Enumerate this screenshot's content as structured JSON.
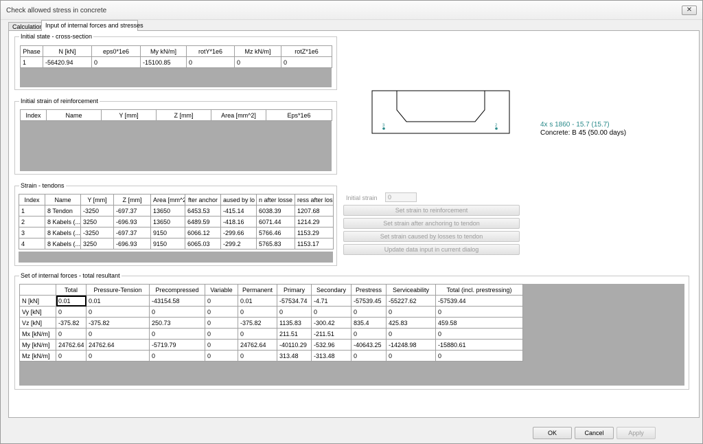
{
  "window": {
    "title": "Check allowed stress in concrete"
  },
  "tabs": [
    {
      "label": "Calculation"
    },
    {
      "label": "Input of internal forces and stresses"
    }
  ],
  "initial_state": {
    "title": "Initial state - cross-section",
    "columns": [
      "Phase",
      "N [kN]",
      "eps0*1e6",
      "My kN/m]",
      "rotY*1e6",
      "Mz kN/m]",
      "rotZ*1e6"
    ],
    "rows": [
      [
        "1",
        "-56420.94",
        "0",
        "-15100.85",
        "0",
        "0",
        "0"
      ]
    ]
  },
  "initial_strain": {
    "title": "Initial strain of reinforcement",
    "columns": [
      "Index",
      "Name",
      "Y [mm]",
      "Z [mm]",
      "Area [mm^2]",
      "Eps*1e6"
    ]
  },
  "strain_tendons": {
    "title": "Strain - tendons",
    "columns": [
      "Index",
      "Name",
      "Y [mm]",
      "Z [mm]",
      "Area [mm^2",
      "fter anchor",
      "aused by lo",
      "n after losse",
      "ress after loss"
    ],
    "rows": [
      [
        "1",
        "8 Tendon",
        "-3250",
        "-697.37",
        "13650",
        "6453.53",
        "-415.14",
        "6038.39",
        "1207.68"
      ],
      [
        "2",
        "8 Kabels (...",
        "3250",
        "-696.93",
        "13650",
        "6489.59",
        "-418.16",
        "6071.44",
        "1214.29"
      ],
      [
        "3",
        "8 Kabels (...",
        "-3250",
        "-697.37",
        "9150",
        "6066.12",
        "-299.66",
        "5766.46",
        "1153.29"
      ],
      [
        "4",
        "8 Kabels (...",
        "3250",
        "-696.93",
        "9150",
        "6065.03",
        "-299.2",
        "5765.83",
        "1153.17"
      ]
    ]
  },
  "preview": {
    "point_label_left": "3",
    "point_label_right": "2",
    "tendon_text": "4x s 1860 - 15.7 (15.7)",
    "concrete_text": "Concrete: B 45 (50.00 days)",
    "tendon_color": "#2a8a8a"
  },
  "actions": {
    "initial_strain_label": "Initial strain",
    "initial_strain_value": "0",
    "buttons": [
      {
        "label": "Set strain to reinforcement"
      },
      {
        "label": "Set strain after anchoring to tendon"
      },
      {
        "label": "Set strain caused by losses to tendon"
      },
      {
        "label": "Update data input in current dialog"
      }
    ]
  },
  "forces": {
    "title": "Set of internal forces - total resultant",
    "columns": [
      "",
      "Total",
      "Pressure-Tension",
      "Precompressed",
      "Variable",
      "Permanent",
      "Primary",
      "Secondary",
      "Prestress",
      "Serviceability",
      "Total (incl. prestressing)"
    ],
    "rows": [
      [
        "N  [kN]",
        "0.01",
        "0.01",
        "-43154.58",
        "0",
        "0.01",
        "-57534.74",
        "-4.71",
        "-57539.45",
        "-55227.62",
        "-57539.44"
      ],
      [
        "Vy [kN]",
        "0",
        "0",
        "0",
        "0",
        "0",
        "0",
        "0",
        "0",
        "0",
        "0"
      ],
      [
        "Vz [kN]",
        "-375.82",
        "-375.82",
        "250.73",
        "0",
        "-375.82",
        "1135.83",
        "-300.42",
        "835.4",
        "425.83",
        "459.58"
      ],
      [
        "Mx [kN/m]",
        "0",
        "0",
        "0",
        "0",
        "0",
        "211.51",
        "-211.51",
        "0",
        "0",
        "0"
      ],
      [
        "My [kN/m]",
        "24762.64",
        "24762.64",
        "-5719.79",
        "0",
        "24762.64",
        "-40110.29",
        "-532.96",
        "-40643.25",
        "-14248.98",
        "-15880.61"
      ],
      [
        "Mz [kN/m]",
        "0",
        "0",
        "0",
        "0",
        "0",
        "313.48",
        "-313.48",
        "0",
        "0",
        "0"
      ]
    ]
  },
  "footer": {
    "ok": "OK",
    "cancel": "Cancel",
    "apply": "Apply"
  }
}
